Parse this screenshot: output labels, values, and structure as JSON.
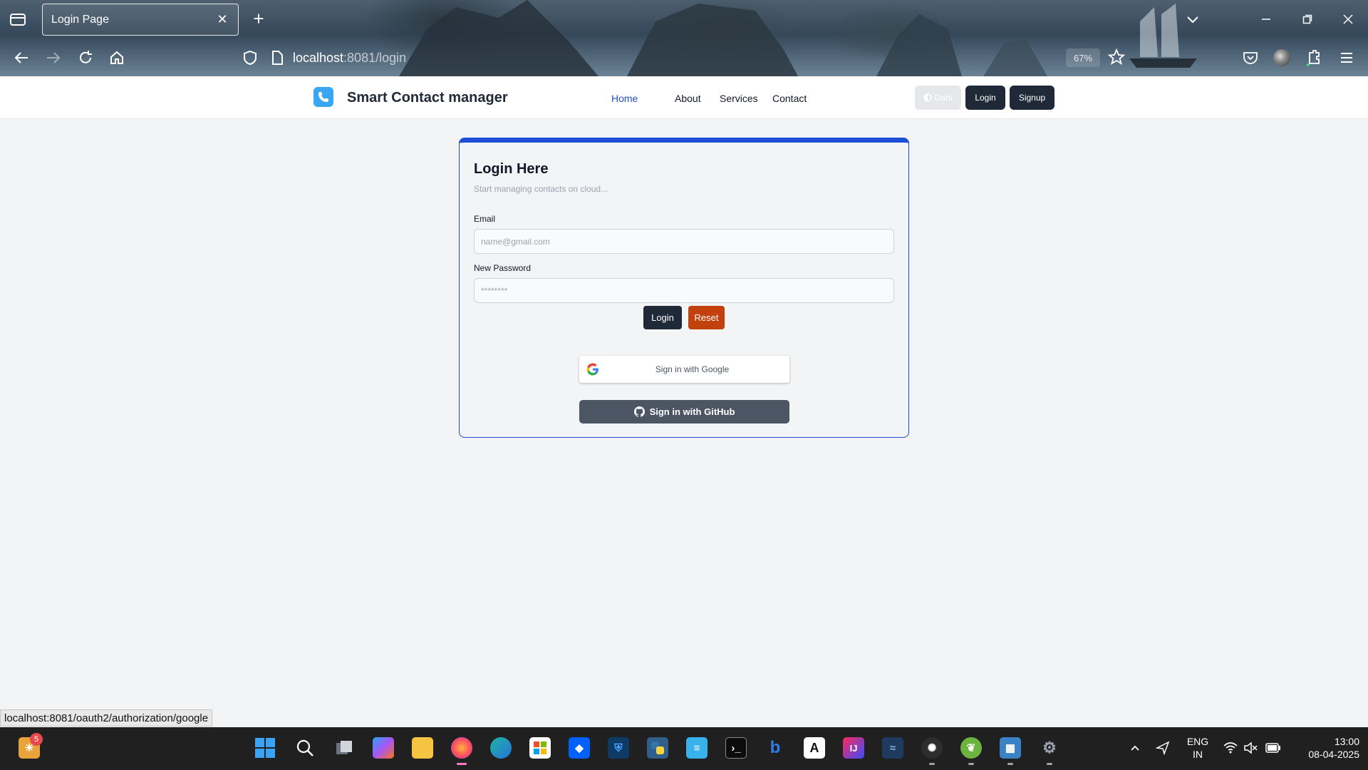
{
  "browser": {
    "tab_title": "Login Page",
    "url_host": "localhost",
    "url_rest": ":8081/login",
    "zoom": "67%"
  },
  "site": {
    "brand": "Smart Contact manager",
    "nav": [
      "Home",
      "About",
      "Services",
      "Contact"
    ],
    "dark_label": "Dark",
    "login_label": "Login",
    "signup_label": "Signup"
  },
  "form": {
    "title": "Login Here",
    "subtitle": "Start managing contacts on cloud...",
    "email_label": "Email",
    "email_placeholder": "name@gmail.com",
    "password_label": "New Password",
    "password_placeholder": "********",
    "login_button": "Login",
    "reset_button": "Reset",
    "google_button": "Sign in with Google",
    "github_button": "Sign in with GitHub"
  },
  "status_url": "localhost:8081/oauth2/authorization/google",
  "taskbar": {
    "widget_badge": "5",
    "lang_top": "ENG",
    "lang_bottom": "IN",
    "time": "13:00",
    "date": "08-04-2025"
  },
  "colors": {
    "accent": "#1d4ed8",
    "reset": "#c2410c",
    "dark_button": "#1f2937",
    "github": "#4b5563"
  }
}
